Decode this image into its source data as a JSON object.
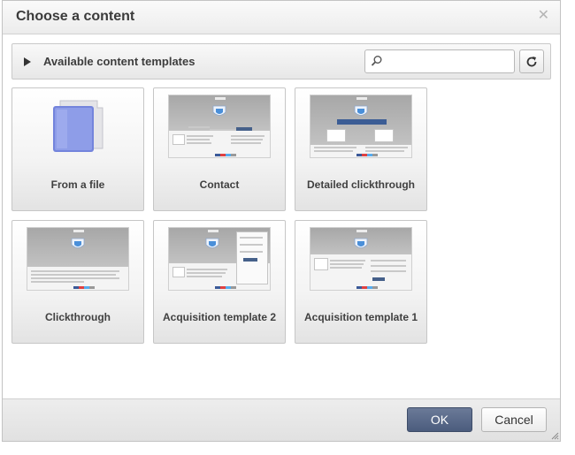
{
  "dialog": {
    "title": "Choose a content",
    "close_icon": "close-icon"
  },
  "toolbar": {
    "label": "Available content templates",
    "search_value": "",
    "search_placeholder": "",
    "search_icon": "search-icon",
    "refresh_icon": "refresh-icon"
  },
  "templates": [
    {
      "label": "From a file",
      "thumbnail": "folder-icon"
    },
    {
      "label": "Contact",
      "thumbnail": "contact-template-thumbnail"
    },
    {
      "label": "Detailed clickthrough",
      "thumbnail": "detailed-clickthrough-thumbnail"
    },
    {
      "label": "Clickthrough",
      "thumbnail": "clickthrough-thumbnail"
    },
    {
      "label": "Acquisition template 2",
      "thumbnail": "acquisition-template-2-thumbnail"
    },
    {
      "label": "Acquisition template 1",
      "thumbnail": "acquisition-template-1-thumbnail"
    }
  ],
  "footer": {
    "ok_label": "OK",
    "cancel_label": "Cancel"
  },
  "colors": {
    "ok_button": "#4f5f80",
    "thumbnail_banner": "#3c5d95",
    "folder": "#7e8fe0"
  }
}
